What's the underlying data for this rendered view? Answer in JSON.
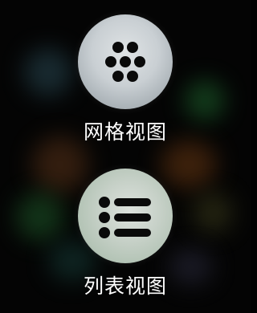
{
  "view_options": [
    {
      "id": "grid",
      "label": "网格视图",
      "icon": "grid-dots-icon"
    },
    {
      "id": "list",
      "label": "列表视图",
      "icon": "list-bullets-icon"
    }
  ],
  "colors": {
    "background": "#040404",
    "icon_fill": "#0a0a0a",
    "label": "#ffffff"
  }
}
